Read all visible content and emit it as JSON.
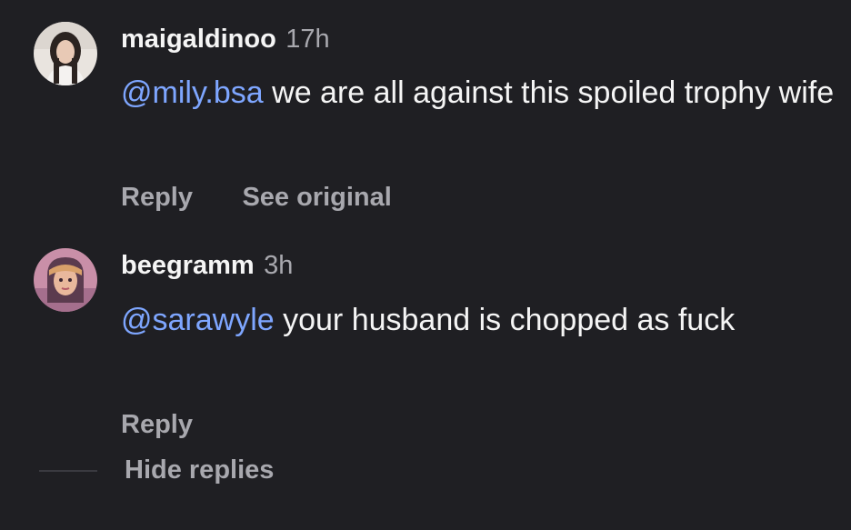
{
  "comments": [
    {
      "username": "maigaldinoo",
      "time": "17h",
      "mention": "@mily.bsa",
      "text": " we are all against this spoiled trophy wife",
      "actions": [
        "Reply",
        "See original"
      ]
    },
    {
      "username": "beegramm",
      "time": "3h",
      "mention": "@sarawyle",
      "text": " your husband is chopped as fuck",
      "actions": [
        "Reply"
      ]
    }
  ],
  "thread": {
    "hide_replies_label": "Hide replies"
  },
  "colors": {
    "background": "#1f1f23",
    "text": "#f5f5f5",
    "muted": "#a8a8ae",
    "mention": "#7ea6ff"
  }
}
